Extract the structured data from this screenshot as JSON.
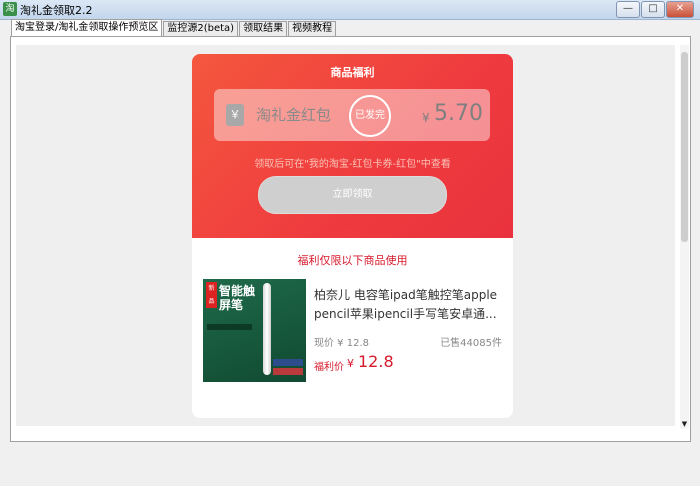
{
  "window": {
    "title": "淘礼金领取2.2",
    "app_icon": "app-icon",
    "controls": {
      "minimize": "—",
      "maximize": "□",
      "close": "✕"
    }
  },
  "tabs": [
    {
      "label": "淘宝登录/淘礼金领取操作预览区",
      "active": true
    },
    {
      "label": "监控源2(beta)",
      "active": false
    },
    {
      "label": "领取结果",
      "active": false
    },
    {
      "label": "视频教程",
      "active": false
    }
  ],
  "card": {
    "title": "商品福利",
    "coupon_icon": "￥",
    "coupon_name": "淘礼金红包",
    "badge": "已发完",
    "price_symbol": "¥",
    "price_amount": "5.70",
    "hint": "领取后可在\"我的淘宝-红包卡券-红包\"中查看",
    "claim_button": "立即领取",
    "accent_color": "#ef3b3f"
  },
  "product": {
    "restriction": "福利仅限以下商品使用",
    "image_headline": "智能触屏笔",
    "image_tag": "新品",
    "title": "柏奈儿 电容笔ipad笔触控笔apple pencil苹果ipencil手写笔安卓通...",
    "orig_price_label": "现价 ¥ 12.8",
    "sold_label": "已售44085件",
    "fuli_label": "福利价",
    "fuli_symbol": "¥",
    "fuli_amount": "12.8",
    "price_color": "#d7192b"
  }
}
